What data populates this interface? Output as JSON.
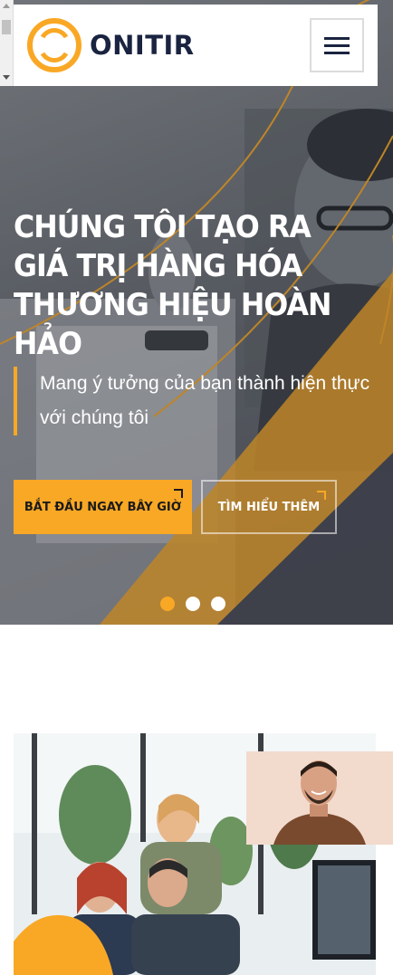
{
  "header": {
    "brand": "ONITIR",
    "logo_icon": "onitir-ring-logo-icon",
    "menu_icon": "hamburger-menu-icon"
  },
  "hero": {
    "title": "CHÚNG TÔI TẠO RA GIÁ TRỊ HÀNG HÓA THƯƠNG HIỆU HOÀN HẢO",
    "subtitle": "Mang ý tưởng của bạn thành hiện thực với chúng tôi",
    "primary_button": "BẮT ĐẦU NGAY BÂY GIỜ",
    "secondary_button": "TÌM HIỂU THÊM",
    "slides": 3,
    "active_slide": 1
  },
  "colors": {
    "accent": "#f9a825",
    "navy": "#1a2440",
    "white": "#ffffff"
  }
}
